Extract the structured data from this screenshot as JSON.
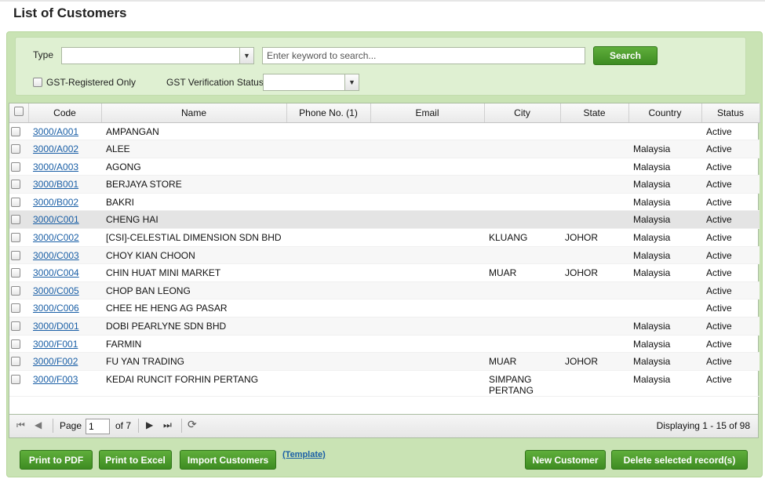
{
  "page": {
    "title": "List of Customers"
  },
  "filters": {
    "type_label": "Type",
    "type_value": "",
    "search_placeholder": "Enter keyword to search...",
    "search_button": "Search",
    "gst_registered_label": "GST-Registered Only",
    "gst_status_label": "GST Verification Status",
    "gst_status_value": ""
  },
  "table": {
    "columns": [
      "Code",
      "Name",
      "Phone No. (1)",
      "Email",
      "City",
      "State",
      "Country",
      "Status"
    ],
    "rows": [
      {
        "code": "3000/A001",
        "name": "AMPANGAN",
        "phone": "",
        "email": "",
        "city": "",
        "state": "",
        "country": "",
        "status": "Active"
      },
      {
        "code": "3000/A002",
        "name": "ALEE",
        "phone": "",
        "email": "",
        "city": "",
        "state": "",
        "country": "Malaysia",
        "status": "Active"
      },
      {
        "code": "3000/A003",
        "name": "AGONG",
        "phone": "",
        "email": "",
        "city": "",
        "state": "",
        "country": "Malaysia",
        "status": "Active"
      },
      {
        "code": "3000/B001",
        "name": "BERJAYA STORE",
        "phone": "",
        "email": "",
        "city": "",
        "state": "",
        "country": "Malaysia",
        "status": "Active"
      },
      {
        "code": "3000/B002",
        "name": "BAKRI",
        "phone": "",
        "email": "",
        "city": "",
        "state": "",
        "country": "Malaysia",
        "status": "Active"
      },
      {
        "code": "3000/C001",
        "name": "CHENG HAI",
        "phone": "",
        "email": "",
        "city": "",
        "state": "",
        "country": "Malaysia",
        "status": "Active",
        "selected": true
      },
      {
        "code": "3000/C002",
        "name": "[CSI]-CELESTIAL DIMENSION SDN BHD",
        "phone": "",
        "email": "",
        "city": "KLUANG",
        "state": "JOHOR",
        "country": "Malaysia",
        "status": "Active"
      },
      {
        "code": "3000/C003",
        "name": "CHOY KIAN CHOON",
        "phone": "",
        "email": "",
        "city": "",
        "state": "",
        "country": "Malaysia",
        "status": "Active"
      },
      {
        "code": "3000/C004",
        "name": "CHIN HUAT MINI MARKET",
        "phone": "",
        "email": "",
        "city": "MUAR",
        "state": "JOHOR",
        "country": "Malaysia",
        "status": "Active"
      },
      {
        "code": "3000/C005",
        "name": "CHOP BAN LEONG",
        "phone": "",
        "email": "",
        "city": "",
        "state": "",
        "country": "",
        "status": "Active"
      },
      {
        "code": "3000/C006",
        "name": "CHEE HE HENG AG PASAR",
        "phone": "",
        "email": "",
        "city": "",
        "state": "",
        "country": "",
        "status": "Active"
      },
      {
        "code": "3000/D001",
        "name": "DOBI PEARLYNE SDN BHD",
        "phone": "",
        "email": "",
        "city": "",
        "state": "",
        "country": "Malaysia",
        "status": "Active"
      },
      {
        "code": "3000/F001",
        "name": "FARMIN",
        "phone": "",
        "email": "",
        "city": "",
        "state": "",
        "country": "Malaysia",
        "status": "Active"
      },
      {
        "code": "3000/F002",
        "name": "FU YAN TRADING",
        "phone": "",
        "email": "",
        "city": "MUAR",
        "state": "JOHOR",
        "country": "Malaysia",
        "status": "Active"
      },
      {
        "code": "3000/F003",
        "name": "KEDAI RUNCIT FORHIN PERTANG",
        "phone": "",
        "email": "",
        "city": "SIMPANG PERTANG",
        "state": "",
        "country": "Malaysia",
        "status": "Active"
      }
    ]
  },
  "pager": {
    "page_label": "Page",
    "page_value": "1",
    "of_label": "of 7",
    "display_text": "Displaying 1 - 15 of 98"
  },
  "actions": {
    "print_pdf": "Print to PDF",
    "print_excel": "Print to Excel",
    "import": "Import Customers",
    "template": "(Template)",
    "new_customer": "New Customer",
    "delete_selected": "Delete selected record(s)"
  }
}
